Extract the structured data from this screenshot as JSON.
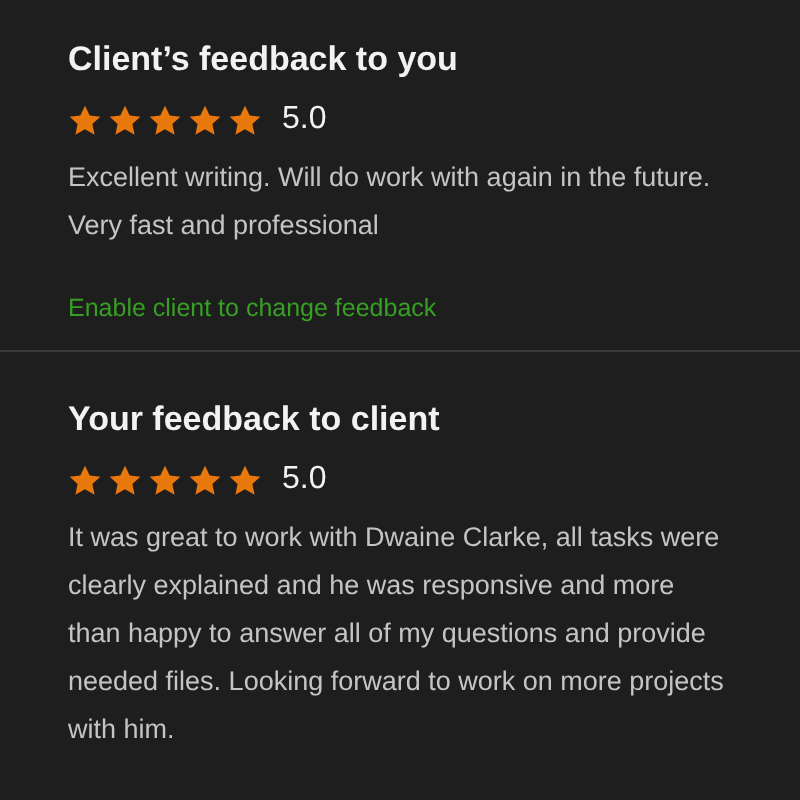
{
  "sections": [
    {
      "title": "Client’s feedback to you",
      "stars": 5,
      "rating": "5.0",
      "text": "Excellent writing. Will do work with again in the future. Very fast and professional",
      "link": "Enable client to change feedback"
    },
    {
      "title": "Your feedback to client",
      "stars": 5,
      "rating": "5.0",
      "text": "It was great to work with Dwaine Clarke, all tasks were clearly explained and he was responsive and more than happy to answer all of my questions and provide needed files. Looking forward to work on more projects with him."
    }
  ]
}
